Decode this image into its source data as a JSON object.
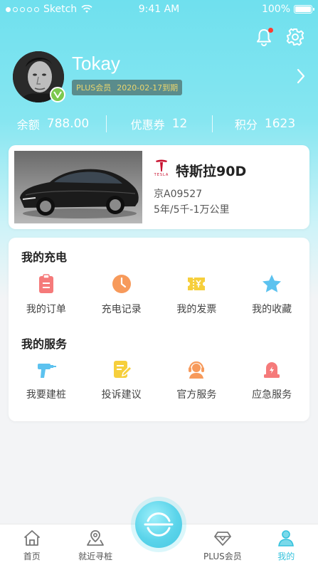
{
  "status_bar": {
    "carrier": "Sketch",
    "time": "9:41 AM",
    "battery": "100%",
    "battery_level": 1.0
  },
  "profile": {
    "name": "Tokay",
    "membership": "PLUS会员",
    "expiry": "2020-02-17到期"
  },
  "stats": [
    {
      "label": "余额",
      "value": "788.00"
    },
    {
      "label": "优惠券",
      "value": "12"
    },
    {
      "label": "积分",
      "value": "1623"
    }
  ],
  "car": {
    "brand_word": "TESLA",
    "model": "特斯拉90D",
    "plate": "京A09527",
    "warranty": "5年/5千-1万公里"
  },
  "charging": {
    "title": "我的充电",
    "items": [
      {
        "label": "我的订单",
        "icon": "clipboard-icon",
        "color": "#f57a7a"
      },
      {
        "label": "充电记录",
        "icon": "clock-icon",
        "color": "#f79a5b"
      },
      {
        "label": "我的发票",
        "icon": "ticket-icon",
        "color": "#f6cf3c"
      },
      {
        "label": "我的收藏",
        "icon": "star-icon",
        "color": "#5cc2ef"
      }
    ]
  },
  "services": {
    "title": "我的服务",
    "items": [
      {
        "label": "我要建桩",
        "icon": "drill-icon",
        "color": "#5cc2ef"
      },
      {
        "label": "投诉建议",
        "icon": "edit-note-icon",
        "color": "#f6cf3c"
      },
      {
        "label": "官方服务",
        "icon": "headset-icon",
        "color": "#f79a5b"
      },
      {
        "label": "应急服务",
        "icon": "emergency-light-icon",
        "color": "#f57a7a"
      }
    ]
  },
  "tabbar": [
    {
      "label": "首页",
      "icon": "home-icon"
    },
    {
      "label": "就近寻桩",
      "icon": "map-pin-icon"
    },
    {
      "label": "",
      "icon": "scan-icon"
    },
    {
      "label": "PLUS会员",
      "icon": "diamond-icon"
    },
    {
      "label": "我的",
      "icon": "user-icon"
    }
  ],
  "colors": {
    "accent": "#35c2dd",
    "hero": "#6fe0ee"
  }
}
